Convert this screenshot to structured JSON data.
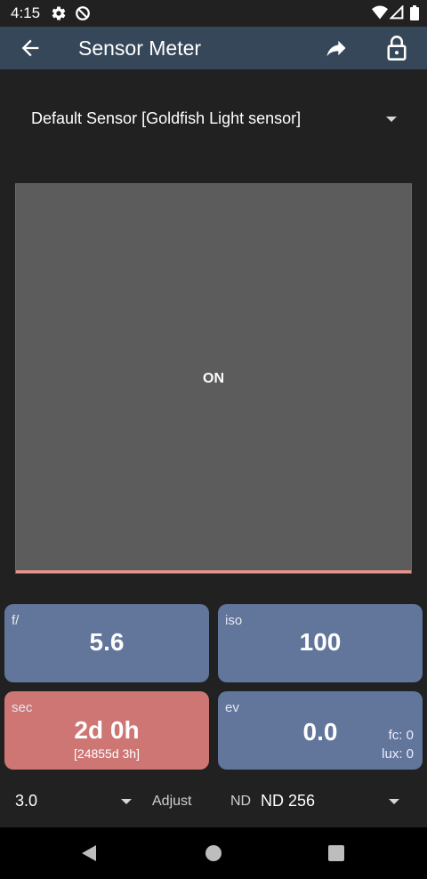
{
  "status_bar": {
    "time": "4:15",
    "icons": [
      "gear-icon",
      "dnd-icon",
      "wifi-icon",
      "signal-icon",
      "battery-icon"
    ]
  },
  "app_bar": {
    "title": "Sensor Meter",
    "icons": [
      "back-arrow-icon",
      "share-icon",
      "lock-icon"
    ],
    "color": "#37475a"
  },
  "sensor_select": {
    "selected": "Default Sensor [Goldfish Light sensor]"
  },
  "display": {
    "status_text": "ON",
    "bar_color": "#e8938f"
  },
  "cards": {
    "aperture": {
      "label": "f/",
      "value": "5.6"
    },
    "iso": {
      "label": "iso",
      "value": "100"
    },
    "shutter": {
      "label": "sec",
      "value": "2d 0h",
      "sub": "[24855d 3h]",
      "color": "#cd7674"
    },
    "ev": {
      "label": "ev",
      "value": "0.0",
      "fc": "fc: 0",
      "lux": "lux: 0"
    }
  },
  "controls": {
    "step_value": "3.0",
    "adjust_label": "Adjust",
    "nd_label": "ND",
    "nd_value": "ND 256"
  },
  "nav_bar": {
    "icons": [
      "nav-back-icon",
      "nav-home-icon",
      "nav-recents-icon"
    ]
  },
  "colors": {
    "background": "#212121",
    "card_blue": "#62759b",
    "card_red": "#cd7674",
    "panel": "#5c5c5c"
  }
}
